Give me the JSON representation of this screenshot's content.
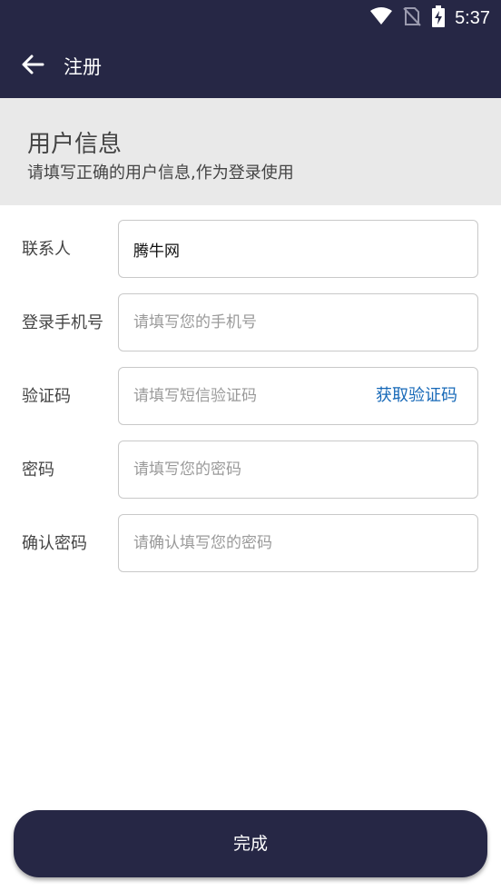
{
  "status_bar": {
    "time": "5:37"
  },
  "toolbar": {
    "title": "注册"
  },
  "section": {
    "heading": "用户信息",
    "subtitle": "请填写正确的用户信息,作为登录使用"
  },
  "form": {
    "contact": {
      "label": "联系人",
      "value": "腾牛网"
    },
    "phone": {
      "label": "登录手机号",
      "placeholder": "请填写您的手机号"
    },
    "code": {
      "label": "验证码",
      "placeholder": "请填写短信验证码",
      "action": "获取验证码"
    },
    "password": {
      "label": "密码",
      "placeholder": "请填写您的密码"
    },
    "confirm": {
      "label": "确认密码",
      "placeholder": "请确认填写您的密码"
    }
  },
  "footer": {
    "done_label": "完成"
  },
  "colors": {
    "primary": "#262745",
    "link": "#1769b8",
    "section_bg": "#e9e9e9"
  }
}
